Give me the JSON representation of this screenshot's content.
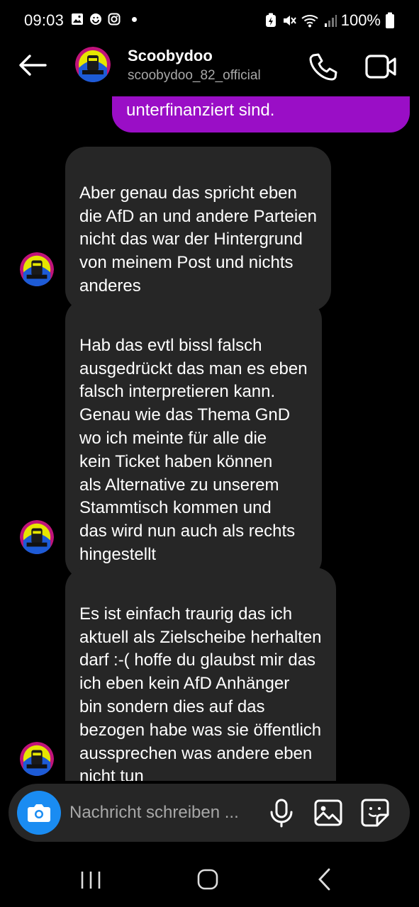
{
  "status_bar": {
    "time": "09:03",
    "battery": "100%"
  },
  "header": {
    "name": "Scoobydoo",
    "username": "scoobydoo_82_official"
  },
  "messages": [
    {
      "direction": "outgoing",
      "text": "unterfinanziert sind."
    },
    {
      "direction": "incoming",
      "text": "Aber genau das spricht eben\ndie AfD an und andere Parteien\nnicht das war der Hintergrund\nvon meinem Post und nichts\nanderes"
    },
    {
      "direction": "incoming",
      "text": "Hab das evtl bissl falsch\nausgedrückt das man es eben\nfalsch interpretieren kann.\nGenau wie das Thema GnD\nwo ich meinte für alle die\nkein Ticket haben können\nals Alternative zu unserem\nStammtisch kommen und\ndas wird nun auch als rechts\nhingestellt"
    },
    {
      "direction": "incoming",
      "text": "Es ist einfach traurig das ich\naktuell als Zielscheibe herhalten\ndarf :-( hoffe du glaubst mir das\nich eben kein AfD Anhänger\nbin sondern dies auf das\nbezogen habe was sie öffentlich\naussprechen was andere eben\nnicht tun"
    }
  ],
  "composer": {
    "placeholder": "Nachricht schreiben ..."
  },
  "colors": {
    "outgoing_bubble": "#9a0ec6",
    "incoming_bubble": "#262626",
    "camera_button": "#1a8cf2",
    "background": "#000000"
  },
  "icons": {
    "back": "arrow-left-icon",
    "call": "phone-icon",
    "video": "video-camera-icon",
    "camera": "camera-icon",
    "mic": "microphone-icon",
    "gallery": "image-icon",
    "sticker": "sticker-icon"
  }
}
